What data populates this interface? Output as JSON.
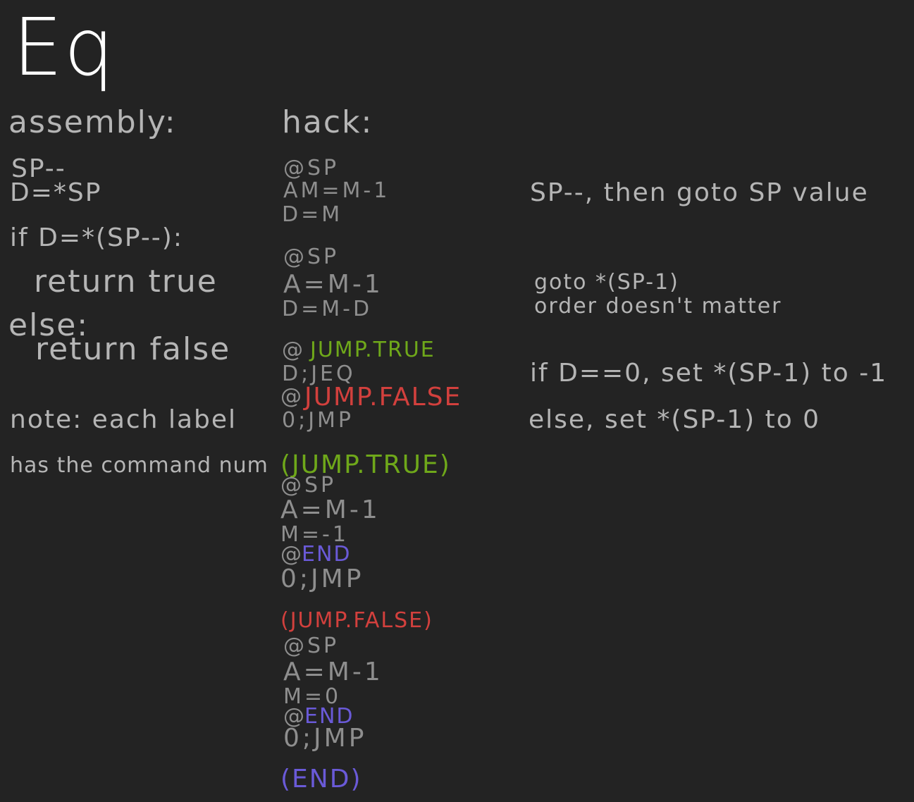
{
  "title": "Eq",
  "assembly": {
    "heading": "assembly:",
    "lines": [
      "SP--",
      "D=*SP",
      "if D=*(SP--):",
      "return true",
      "else:",
      "return false"
    ],
    "note_line1": "note: each label",
    "note_line2": "has the command num"
  },
  "hack": {
    "heading": "hack:",
    "block1": [
      "@SP",
      "AM=M-1",
      "D=M"
    ],
    "block2": [
      "@SP",
      "A=M-1",
      "D=M-D"
    ],
    "jump_true_at": "@",
    "jump_true_label": "JUMP.TRUE",
    "jeq": "D;JEQ",
    "jump_false_at": "@",
    "jump_false_label": "JUMP.FALSE",
    "jmp1": "0;JMP",
    "label_true": "(JUMP.TRUE)",
    "block_true": [
      "@SP",
      "A=M-1",
      "M=-1"
    ],
    "end_at_1": "@",
    "end_label_1": "END",
    "jmp2": "0;JMP",
    "label_false": "(JUMP.FALSE)",
    "block_false": [
      "@SP",
      "A=M-1",
      "M=0"
    ],
    "end_at_2": "@",
    "end_label_2": "END",
    "jmp3": "0;JMP",
    "label_end": "(END)"
  },
  "comments": {
    "c1": "SP--, then goto SP value",
    "c2": "goto *(SP-1)",
    "c3": "order doesn't matter",
    "c4": "if D==0, set *(SP-1) to -1",
    "c5": "else, set *(SP-1) to 0"
  },
  "colors": {
    "background": "#232323",
    "title": "#ffffff",
    "text": "#b5b5b5",
    "code": "#8e8e8e",
    "true_label": "#6fa81a",
    "false_label": "#d2403d",
    "end_label": "#6a5ad8"
  }
}
